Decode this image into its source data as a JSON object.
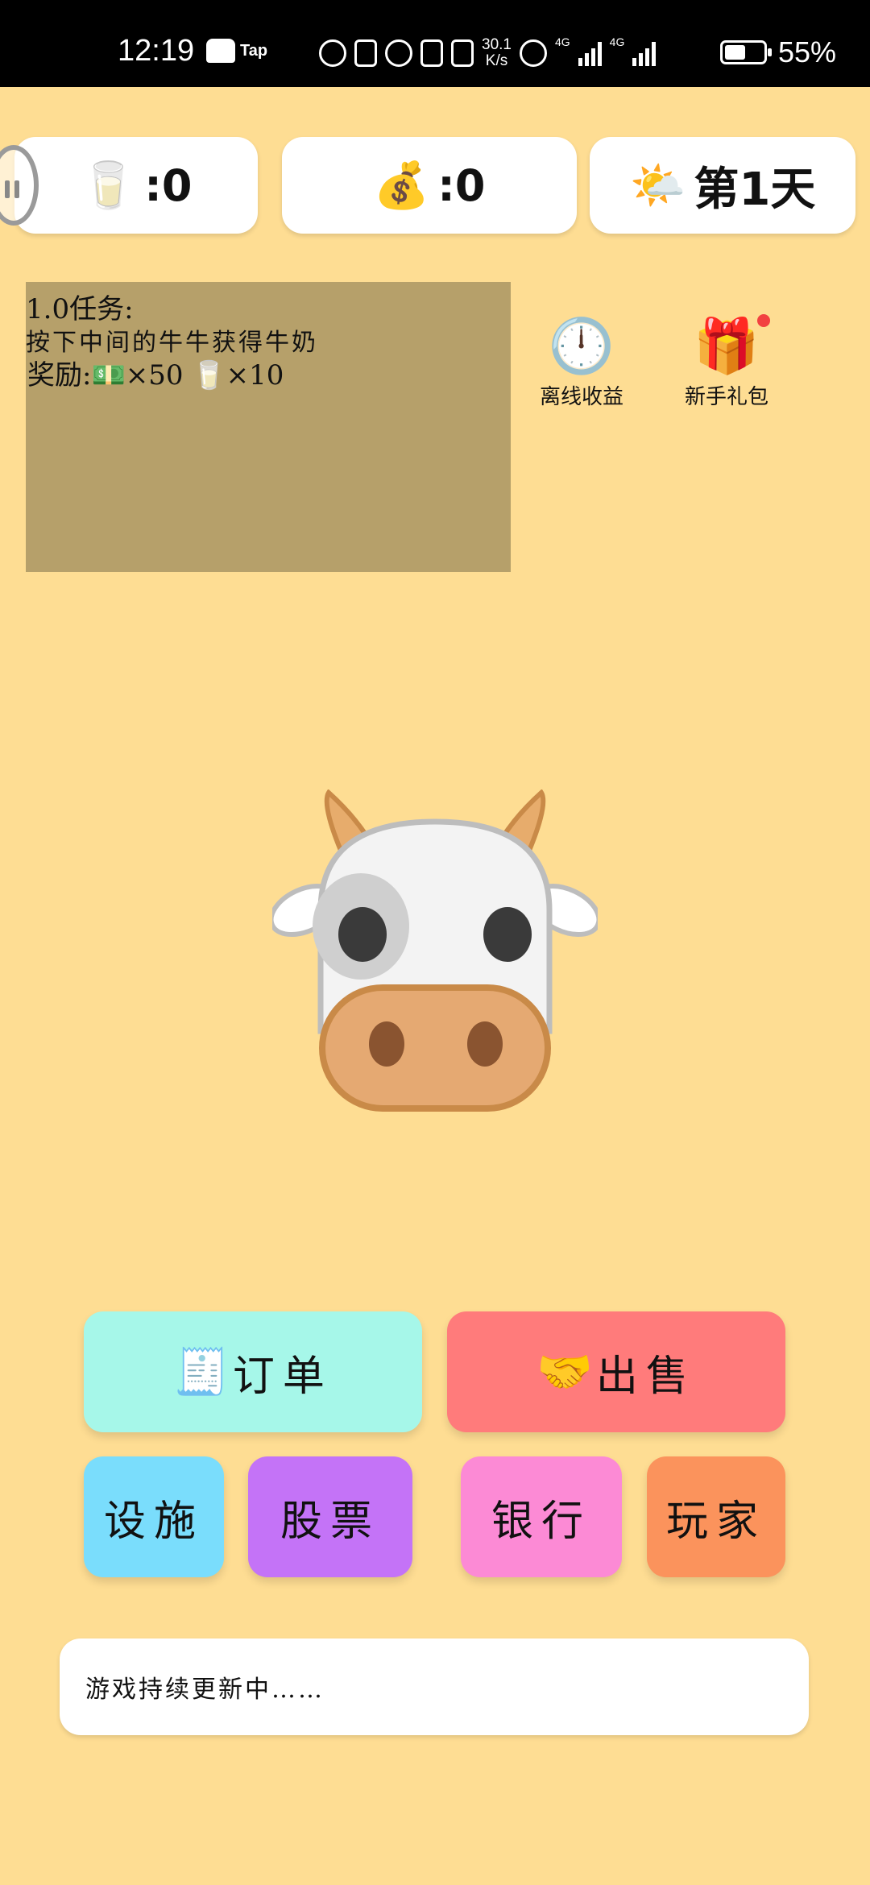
{
  "status_bar": {
    "time": "12:19",
    "tap_label": "Tap",
    "net_speed": "30.1\nK/s",
    "network_type_1": "4G",
    "network_type_2": "4G",
    "battery_percent": "55%",
    "battery_level": 0.55
  },
  "resources": {
    "milk_icon": "🥛",
    "milk_value": ":0",
    "money_icon": "💰",
    "money_value": ":0",
    "weather_icon": "🌤️",
    "day_label": "第1天"
  },
  "task": {
    "title": "1.0任务:",
    "description": "按下中间的牛牛获得牛奶",
    "reward": "奖励:💵×50 🥛×10"
  },
  "side_buttons": {
    "offline_icon": "🕛",
    "offline_label": "离线收益",
    "gift_icon": "🎁",
    "gift_label": "新手礼包"
  },
  "cow_icon": "cow-face-icon",
  "buttons": {
    "order_emoji": "🧾",
    "order_label": "订单",
    "sell_emoji": "🤝",
    "sell_label": "出售",
    "facilities": "设施",
    "stocks": "股票",
    "bank": "银行",
    "players": "玩家"
  },
  "notice": "游戏持续更新中……",
  "colors": {
    "background": "#FEDD93",
    "task_box": "#B6A06A",
    "order": "#A6F7E9",
    "sell": "#FF7B7B",
    "facilities": "#7ADDFC",
    "stocks": "#C473F7",
    "bank": "#FC8AD5",
    "players": "#FB935C"
  }
}
